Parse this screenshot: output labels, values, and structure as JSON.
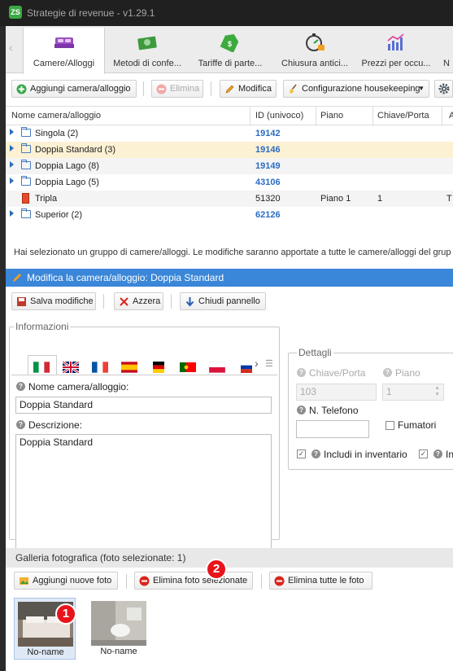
{
  "window": {
    "title": "Strategie di revenue - v1.29.1",
    "logo": "ZS"
  },
  "nav": {
    "tabs": [
      {
        "label": "Camere/Alloggi",
        "icon": "bed-icon"
      },
      {
        "label": "Metodi di confe...",
        "icon": "money-icon"
      },
      {
        "label": "Tariffe di parte...",
        "icon": "price-tag-icon"
      },
      {
        "label": "Chiusura antici...",
        "icon": "stopwatch-lock-icon"
      },
      {
        "label": "Prezzi per occu...",
        "icon": "bar-chart-icon"
      },
      {
        "label": "N"
      }
    ]
  },
  "toolbar": {
    "add": "Aggiungi camera/alloggio",
    "delete": "Elimina",
    "edit": "Modifica",
    "housekeeping": "Configurazione housekeeping"
  },
  "grid": {
    "headers": {
      "name": "Nome camera/alloggio",
      "id": "ID (univoco)",
      "floor": "Piano",
      "key": "Chiave/Porta",
      "extra": "A"
    },
    "rows": [
      {
        "name": "Singola (2)",
        "id": "19142",
        "floor": "",
        "key": "",
        "extra": ""
      },
      {
        "name": "Doppia Standard (3)",
        "id": "19146",
        "floor": "",
        "key": "",
        "extra": ""
      },
      {
        "name": "Doppia Lago (8)",
        "id": "19149",
        "floor": "",
        "key": "",
        "extra": ""
      },
      {
        "name": "Doppia Lago (5)",
        "id": "43106",
        "floor": "",
        "key": "",
        "extra": ""
      },
      {
        "name": "Tripla",
        "id": "51320",
        "floor": "Piano 1",
        "key": "1",
        "extra": "T"
      },
      {
        "name": "Superior (2)",
        "id": "62126",
        "floor": "",
        "key": "",
        "extra": ""
      }
    ]
  },
  "info_message": "Hai selezionato un gruppo di camere/alloggi. Le modifiche saranno apportate a tutte le camere/alloggi del grup",
  "edit_panel": {
    "title": "Modifica la camera/alloggio: Doppia Standard",
    "save": "Salva modifiche",
    "reset": "Azzera",
    "close": "Chiudi pannello"
  },
  "info_box": {
    "legend": "Informazioni",
    "name_label": "Nome camera/alloggio:",
    "name_value": "Doppia Standard",
    "desc_label": "Descrizione:",
    "desc_value": "Doppia Standard"
  },
  "details_box": {
    "legend": "Dettagli",
    "key_label": "Chiave/Porta",
    "key_placeholder": "103",
    "floor_label": "Piano",
    "floor_placeholder": "1",
    "phone_label": "N. Telefono",
    "smokers_label": "Fumatori",
    "inventory_label": "Includi in inventario",
    "cut_label": "In"
  },
  "gallery": {
    "title": "Galleria fotografica (foto selezionate: 1)",
    "add": "Aggiungi nuove foto",
    "delete_selected": "Elimina foto selezionate",
    "delete_all": "Elimina tutte le foto",
    "photos": [
      {
        "caption": "No-name"
      },
      {
        "caption": "No-name"
      }
    ]
  },
  "annotations": {
    "badge1": "1",
    "badge2": "2"
  }
}
